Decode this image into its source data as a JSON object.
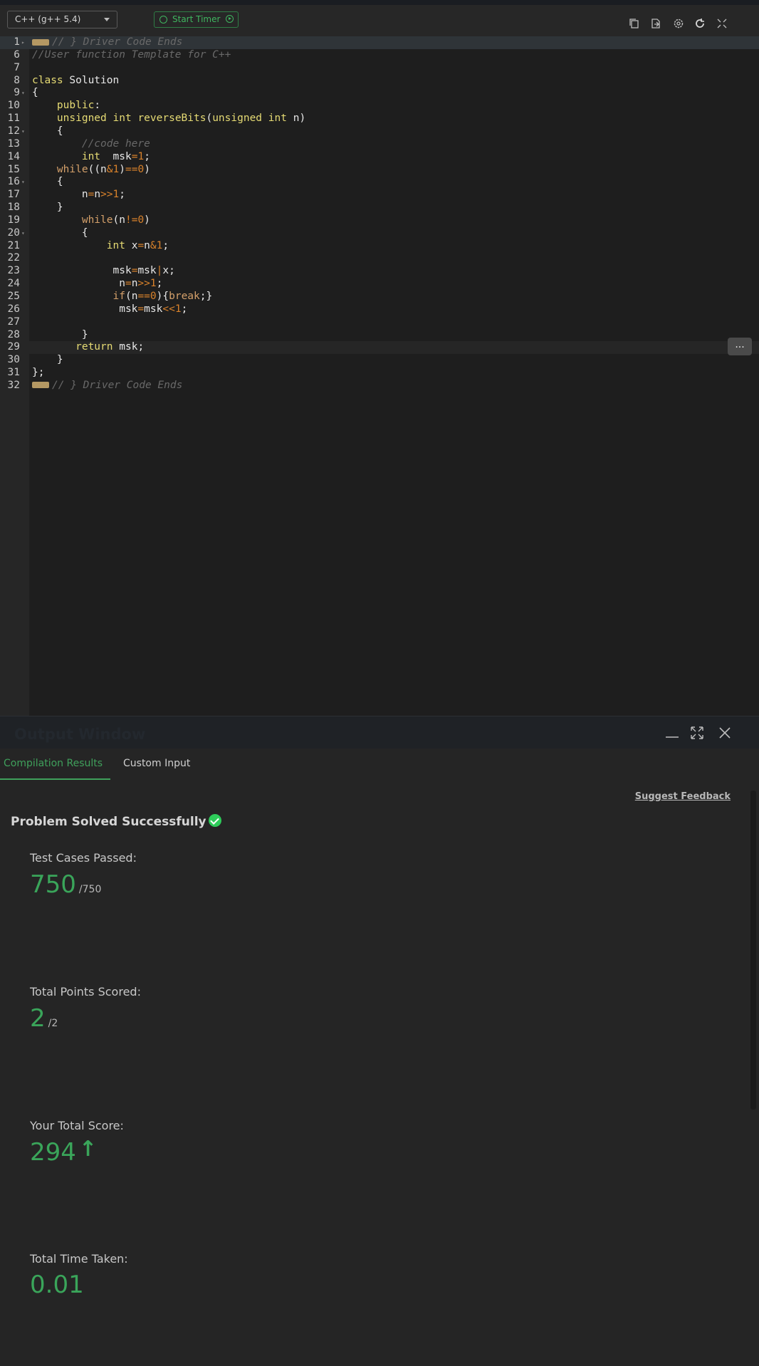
{
  "toolbar": {
    "language": "C++ (g++ 5.4)",
    "timer_label": "Start Timer",
    "icons": [
      "copy-icon",
      "upload-icon",
      "settings-icon",
      "reset-icon",
      "fullscreen-icon"
    ]
  },
  "editor": {
    "more_label": "...",
    "lines": [
      {
        "num": "1",
        "fold": "▸",
        "text": "// } Driver Code Ends"
      },
      {
        "num": "6",
        "fold": "",
        "text": "//User function Template for C++"
      },
      {
        "num": "7",
        "fold": "",
        "text": ""
      },
      {
        "num": "8",
        "fold": "",
        "text": "class Solution"
      },
      {
        "num": "9",
        "fold": "▾",
        "text": "{"
      },
      {
        "num": "10",
        "fold": "",
        "text": "    public:"
      },
      {
        "num": "11",
        "fold": "",
        "text": "    unsigned int reverseBits(unsigned int n)"
      },
      {
        "num": "12",
        "fold": "▾",
        "text": "    {"
      },
      {
        "num": "13",
        "fold": "",
        "text": "        //code here"
      },
      {
        "num": "14",
        "fold": "",
        "text": "        int  msk=1;"
      },
      {
        "num": "15",
        "fold": "",
        "text": "    while((n&1)==0)"
      },
      {
        "num": "16",
        "fold": "▾",
        "text": "    {"
      },
      {
        "num": "17",
        "fold": "",
        "text": "        n=n>>1;"
      },
      {
        "num": "18",
        "fold": "",
        "text": "    }"
      },
      {
        "num": "19",
        "fold": "",
        "text": "        while(n!=0)"
      },
      {
        "num": "20",
        "fold": "▾",
        "text": "        {"
      },
      {
        "num": "21",
        "fold": "",
        "text": "            int x=n&1;"
      },
      {
        "num": "22",
        "fold": "",
        "text": ""
      },
      {
        "num": "23",
        "fold": "",
        "text": "             msk=msk|x;"
      },
      {
        "num": "24",
        "fold": "",
        "text": "              n=n>>1;"
      },
      {
        "num": "25",
        "fold": "",
        "text": "             if(n==0){break;}"
      },
      {
        "num": "26",
        "fold": "",
        "text": "              msk=msk<<1;"
      },
      {
        "num": "27",
        "fold": "",
        "text": ""
      },
      {
        "num": "28",
        "fold": "",
        "text": "        }"
      },
      {
        "num": "29",
        "fold": "",
        "text": "       return msk;"
      },
      {
        "num": "30",
        "fold": "",
        "text": "    }"
      },
      {
        "num": "31",
        "fold": "",
        "text": "};"
      },
      {
        "num": "32",
        "fold": "",
        "text": "// } Driver Code Ends"
      }
    ]
  },
  "output": {
    "title": "Output Window",
    "tabs": [
      "Compilation Results",
      "Custom Input"
    ],
    "suggest_feedback": "Suggest Feedback",
    "status": "Problem Solved Successfully",
    "test_cases_label": "Test Cases Passed:",
    "test_cases_passed": "750",
    "test_cases_total": "/750",
    "points_label": "Total Points Scored:",
    "points": "2",
    "points_total": "/2",
    "score_label": "Your Total Score:",
    "score": "294",
    "time_label": "Total Time Taken:",
    "time": "0.01"
  },
  "colors": {
    "accent_green": "#3aa55a",
    "keyword": "#e6db74",
    "number": "#d9822b",
    "comment": "#696969"
  }
}
